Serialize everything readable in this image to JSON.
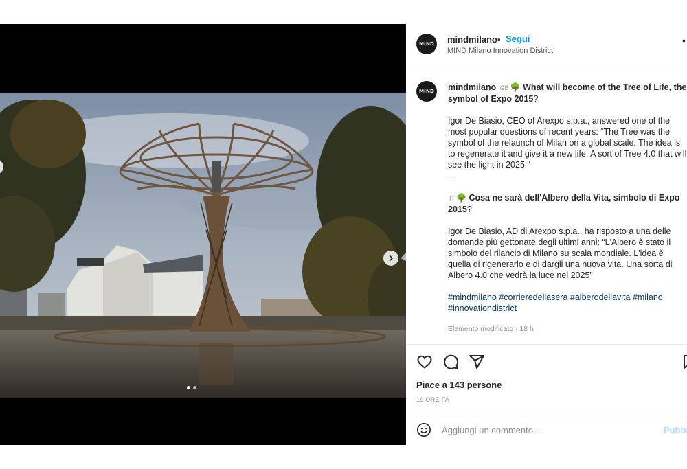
{
  "post": {
    "username": "mindmilano",
    "separator": "•",
    "follow_label": "Segui",
    "location": "MIND Milano Innovation District",
    "more_label": "•",
    "avatar_text": "MIND"
  },
  "caption": {
    "username": "mindmilano",
    "flag_en": "GB",
    "title_en": "What will become of the Tree of Life, the symbol of Expo 2015",
    "title_en_end": "?",
    "body_en": "Igor De Biasio, CEO of Arexpo s.p.a., answered one of the most popular questions of recent years: “The Tree was the symbol of the relaunch of Milan on a global scale. The idea is to regenerate it and give it a new life. A sort of Tree 4.0 that will see the light in 2025 “",
    "divider": "--",
    "flag_it": "IT",
    "title_it": "Cosa ne sarà dell'Albero della Vita, simbolo di Expo 2015",
    "title_it_end": "?",
    "body_it": "Igor De Biasio, AD di Arexpo s.p.a., ha risposto a una delle domande più gettonate degli ultimi anni: “L'Albero è stato il simbolo del rilancio di Milano su scala mondiale. L'idea è quella di rigenerarlo e di dargli una nuova vita. Una sorta di Albero 4.0 che vedrà la luce nel 2025”",
    "hashtags": [
      "#mindmilano",
      "#corrieredellasera",
      "#alberodellavita",
      "#milano",
      "#innovationdistrict"
    ],
    "edited": "Elemento modificato · 18 h"
  },
  "engagement": {
    "likes": "Piace a 143 persone",
    "time": "19 ORE FA"
  },
  "comment": {
    "placeholder": "Aggiungi un commento...",
    "publish_label": "Pubblica"
  },
  "media": {
    "slide_count": 2,
    "active_slide": 1
  },
  "icons": {
    "like": "heart-icon",
    "comment": "comment-icon",
    "share": "share-icon",
    "save": "bookmark-icon",
    "emoji": "smiley-icon",
    "next": "chevron-right-icon"
  },
  "colors": {
    "link": "#0095f6",
    "hashtag": "#00376b",
    "muted": "#8e8e8e",
    "text": "#262626"
  }
}
